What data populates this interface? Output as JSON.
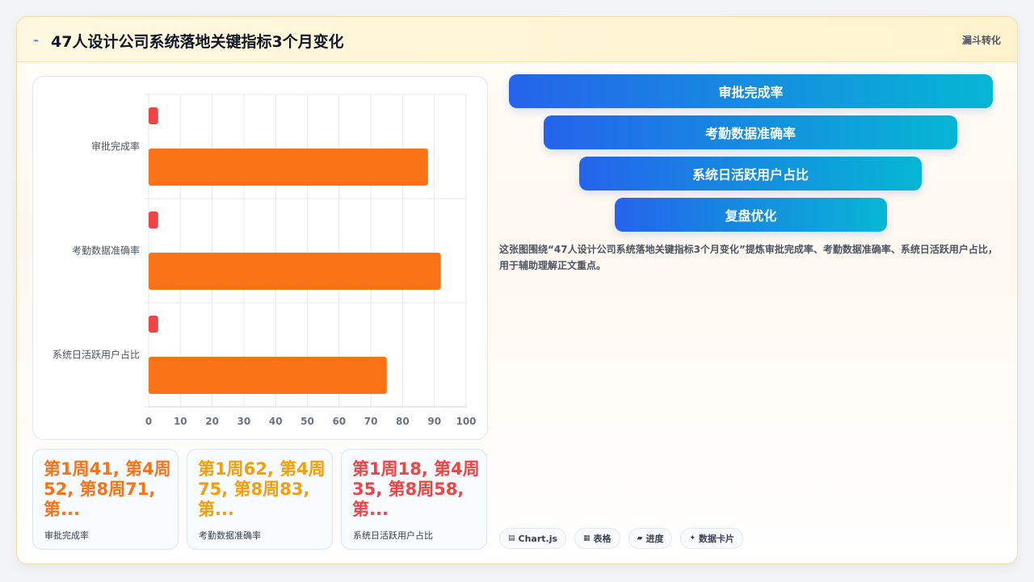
{
  "header": {
    "icon": "trend-icon",
    "title": "47人设计公司系统落地关键指标3个月变化",
    "tag": "漏斗转化"
  },
  "chart_data": {
    "type": "bar",
    "orientation": "horizontal",
    "categories": [
      "审批完成率",
      "考勤数据准确率",
      "系统日活跃用户占比"
    ],
    "series": [
      {
        "values": [
          3,
          3,
          3
        ],
        "color": "#ef4444"
      },
      {
        "values": [
          88,
          92,
          75
        ],
        "color": "#f97316"
      }
    ],
    "x_ticks": [
      0,
      10,
      20,
      30,
      40,
      50,
      60,
      70,
      80,
      90,
      100
    ],
    "xlim": [
      0,
      100
    ],
    "grid": true
  },
  "kpis": [
    {
      "value": "第1周41, 第4周52, 第8周71, 第...",
      "label": "审批完成率",
      "color": "#f97316"
    },
    {
      "value": "第1周62, 第4周75, 第8周83, 第...",
      "label": "考勤数据准确率",
      "color": "#f59e0b"
    },
    {
      "value": "第1周18, 第4周35, 第8周58, 第...",
      "label": "系统日活跃用户占比",
      "color": "#ef4444"
    }
  ],
  "funnel": [
    "审批完成率",
    "考勤数据准确率",
    "系统日活跃用户占比",
    "复盘优化"
  ],
  "description": "这张图围绕“47人设计公司系统落地关键指标3个月变化”提炼审批完成率、考勤数据准确率、系统日活跃用户占比，用于辅助理解正文重点。",
  "chips": [
    {
      "icon": "chart-icon",
      "glyph": "▤",
      "label": "Chart.js"
    },
    {
      "icon": "table-icon",
      "glyph": "▦",
      "label": "表格"
    },
    {
      "icon": "progress-icon",
      "glyph": "▰",
      "label": "进度"
    },
    {
      "icon": "sparkle-icon",
      "glyph": "✦",
      "label": "数据卡片"
    }
  ]
}
